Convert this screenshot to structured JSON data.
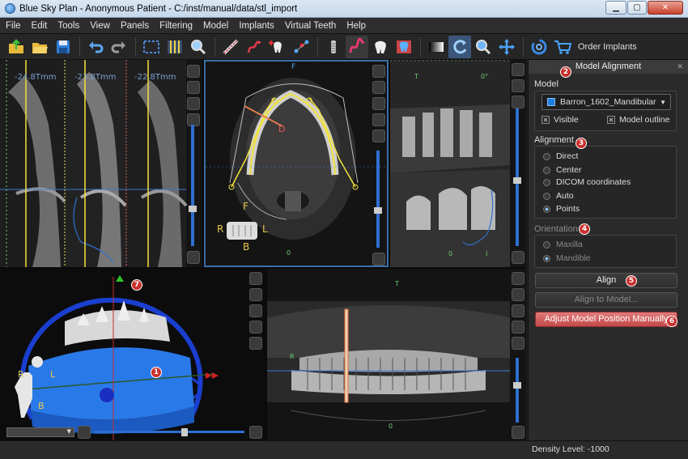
{
  "window": {
    "title": "Blue Sky Plan - Anonymous Patient - C:/inst/manual/data/stl_import"
  },
  "menu": [
    "File",
    "Edit",
    "Tools",
    "View",
    "Panels",
    "Filtering",
    "Model",
    "Implants",
    "Virtual Teeth",
    "Help"
  ],
  "toolbar": {
    "order_implants_label": "Order Implants"
  },
  "views": {
    "slice_measures": [
      "-24.8Tmm",
      "-23.8Tmm",
      "-22.8Tmm"
    ],
    "axial": {
      "top_label": "F",
      "letter_d": "D",
      "orient_r": "R",
      "orient_l": "L",
      "orient_f": "F",
      "orient_b": "B",
      "tick_zero": "0"
    },
    "cross": {
      "t_label": "T",
      "angle": "0°",
      "tick_zero": "0",
      "tick_i": "I"
    },
    "model3d": {
      "r": "R",
      "l": "L",
      "b": "B"
    },
    "panoramic": {
      "t_label": "T",
      "r_label": "R",
      "tick_zero": "0"
    }
  },
  "callouts": [
    "1",
    "2",
    "3",
    "4",
    "5",
    "6",
    "7"
  ],
  "panel": {
    "title": "Model Alignment",
    "model_label": "Model",
    "model_select": "Barron_1602_Mandibular",
    "visible_label": "Visible",
    "outline_label": "Model outline",
    "alignment_label": "Alignment",
    "alignment_options": [
      "Direct",
      "Center",
      "DICOM coordinates",
      "Auto",
      "Points"
    ],
    "alignment_selected": "Points",
    "orientation_label": "Orientation",
    "orientation_options": [
      "Maxilla",
      "Mandible"
    ],
    "orientation_selected": "Mandible",
    "align_button": "Align",
    "align_to_model_button": "Align to Model...",
    "adjust_button": "Adjust Model Position Manually"
  },
  "status": {
    "density": "Density Level: -1000"
  }
}
